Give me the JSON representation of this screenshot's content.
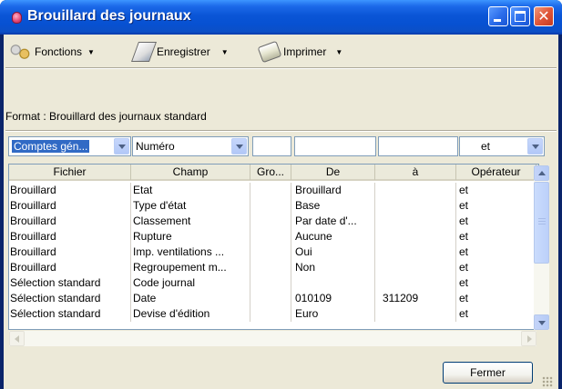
{
  "window": {
    "title": "Brouillard des journaux"
  },
  "toolbar": {
    "fonctions": "Fonctions",
    "enregistrer": "Enregistrer",
    "imprimer": "Imprimer"
  },
  "format_label": "Format : Brouillard des journaux standard",
  "filter": {
    "fichier": "Comptes gén...",
    "champ": "Numéro",
    "groupe": "",
    "de": "",
    "a": "",
    "operateur": "et"
  },
  "grid": {
    "columns": [
      "Fichier",
      "Champ",
      "Gro...",
      "De",
      "à",
      "Opérateur"
    ],
    "rows": [
      [
        "Brouillard",
        "Etat",
        "",
        "Brouillard",
        "",
        "et"
      ],
      [
        "Brouillard",
        "Type d'état",
        "",
        "Base",
        "",
        "et"
      ],
      [
        "Brouillard",
        "Classement",
        "",
        "Par date d'...",
        "",
        "et"
      ],
      [
        "Brouillard",
        "Rupture",
        "",
        "Aucune",
        "",
        "et"
      ],
      [
        "Brouillard",
        "Imp. ventilations ...",
        "",
        "Oui",
        "",
        "et"
      ],
      [
        "Brouillard",
        "Regroupement m...",
        "",
        "Non",
        "",
        "et"
      ],
      [
        "Sélection standard",
        "Code journal",
        "",
        "",
        "",
        "et"
      ],
      [
        "Sélection standard",
        "Date",
        "",
        "010109",
        "311209",
        "et"
      ],
      [
        "Sélection standard",
        "Devise d'édition",
        "",
        "Euro",
        "",
        "et"
      ]
    ]
  },
  "buttons": {
    "close": "Fermer"
  },
  "icons": {
    "app": "journal-icon",
    "fonctions": "gears-icon",
    "enregistrer": "save-icon",
    "imprimer": "print-icon"
  },
  "colors": {
    "titlebar": "#0a55d6",
    "selection": "#316ac5",
    "close_button": "#e0573a"
  }
}
